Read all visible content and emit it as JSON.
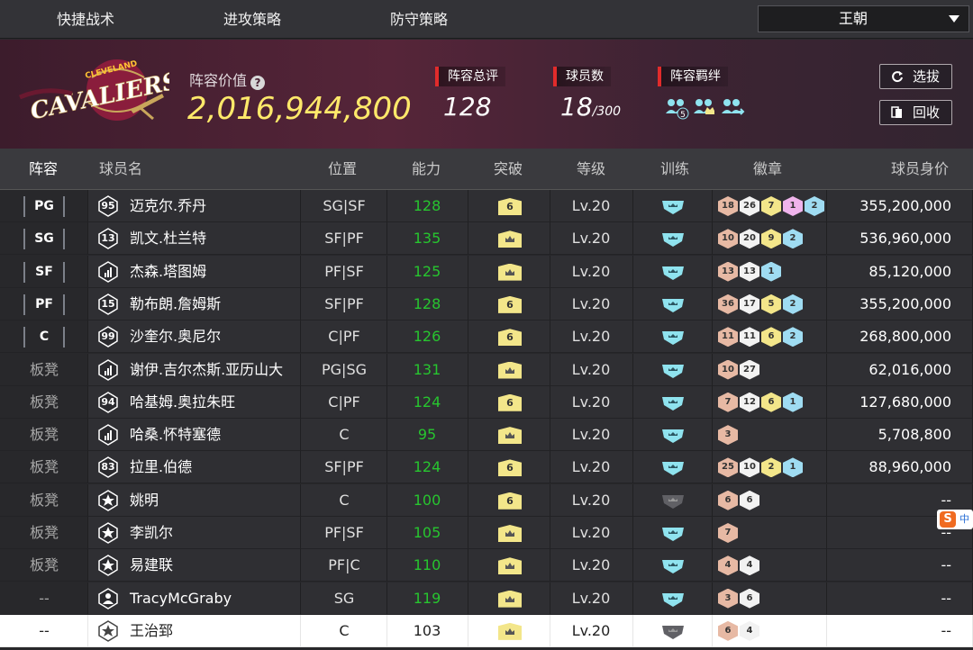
{
  "topnav": {
    "tabs": [
      "快捷战术",
      "进攻策略",
      "防守策略"
    ],
    "dropdown_value": "王朝"
  },
  "team": {
    "logo_text": "CAVALIERS",
    "logo_subtext": "CLEVELAND",
    "value_label": "阵容价值",
    "value": "2,016,944,800",
    "rating_label": "阵容总评",
    "rating": "128",
    "count_label": "球员数",
    "count": "18",
    "count_max": "/300",
    "synergy_label": "阵容羁绊",
    "synergy_icons": [
      "team-synergy-5-icon",
      "team-synergy-crown-icon",
      "team-synergy-arrows-icon"
    ],
    "buttons": {
      "select": "选拔",
      "recycle": "回收"
    }
  },
  "columns": [
    "阵容",
    "球员名",
    "位置",
    "能力",
    "突破",
    "等级",
    "训练",
    "徽章",
    "球员身价"
  ],
  "rows": [
    {
      "slot": "PG",
      "bench": false,
      "emblem": "95",
      "name": "迈克尔.乔丹",
      "pos": "SG|SF",
      "ability": "128",
      "breakthrough": "6",
      "level": "Lv.20",
      "train": "teal",
      "badges": [
        {
          "v": "18",
          "c": "bronze"
        },
        {
          "v": "26",
          "c": "white"
        },
        {
          "v": "7",
          "c": "gold"
        },
        {
          "v": "1",
          "c": "pink"
        },
        {
          "v": "2",
          "c": "blue"
        }
      ],
      "price": "355,200,000"
    },
    {
      "slot": "SG",
      "bench": false,
      "emblem": "13",
      "name": "凯文.杜兰特",
      "pos": "SF|PF",
      "ability": "135",
      "breakthrough": "crown",
      "level": "Lv.20",
      "train": "teal",
      "badges": [
        {
          "v": "10",
          "c": "bronze"
        },
        {
          "v": "20",
          "c": "white"
        },
        {
          "v": "9",
          "c": "gold"
        },
        {
          "v": "2",
          "c": "blue"
        }
      ],
      "price": "536,960,000"
    },
    {
      "slot": "SF",
      "bench": false,
      "emblem": "bars",
      "name": "杰森.塔图姆",
      "pos": "PF|SF",
      "ability": "125",
      "breakthrough": "crown",
      "level": "Lv.20",
      "train": "teal",
      "badges": [
        {
          "v": "13",
          "c": "bronze"
        },
        {
          "v": "13",
          "c": "white"
        },
        {
          "v": "1",
          "c": "blue"
        }
      ],
      "price": "85,120,000"
    },
    {
      "slot": "PF",
      "bench": false,
      "emblem": "15",
      "name": "勒布朗.詹姆斯",
      "pos": "SF|PF",
      "ability": "128",
      "breakthrough": "6",
      "level": "Lv.20",
      "train": "teal",
      "badges": [
        {
          "v": "36",
          "c": "bronze"
        },
        {
          "v": "17",
          "c": "white"
        },
        {
          "v": "5",
          "c": "gold"
        },
        {
          "v": "2",
          "c": "blue"
        }
      ],
      "price": "355,200,000"
    },
    {
      "slot": "C",
      "bench": false,
      "emblem": "99",
      "name": "沙奎尔.奥尼尔",
      "pos": "C|PF",
      "ability": "126",
      "breakthrough": "6",
      "level": "Lv.20",
      "train": "teal",
      "badges": [
        {
          "v": "11",
          "c": "bronze"
        },
        {
          "v": "11",
          "c": "white"
        },
        {
          "v": "6",
          "c": "gold"
        },
        {
          "v": "2",
          "c": "blue"
        }
      ],
      "price": "268,800,000"
    },
    {
      "slot": "板凳",
      "bench": true,
      "emblem": "bars",
      "name": "谢伊.吉尔杰斯.亚历山大",
      "pos": "PG|SG",
      "ability": "131",
      "breakthrough": "crown",
      "level": "Lv.20",
      "train": "teal",
      "badges": [
        {
          "v": "10",
          "c": "bronze"
        },
        {
          "v": "27",
          "c": "white"
        }
      ],
      "price": "62,016,000"
    },
    {
      "slot": "板凳",
      "bench": true,
      "emblem": "94",
      "name": "哈基姆.奥拉朱旺",
      "pos": "C|PF",
      "ability": "124",
      "breakthrough": "6",
      "level": "Lv.20",
      "train": "teal",
      "badges": [
        {
          "v": "7",
          "c": "bronze"
        },
        {
          "v": "12",
          "c": "white"
        },
        {
          "v": "6",
          "c": "gold"
        },
        {
          "v": "1",
          "c": "blue"
        }
      ],
      "price": "127,680,000"
    },
    {
      "slot": "板凳",
      "bench": true,
      "emblem": "bars",
      "name": "哈桑.怀特塞德",
      "pos": "C",
      "ability": "95",
      "breakthrough": "crown",
      "level": "Lv.20",
      "train": "teal",
      "badges": [
        {
          "v": "3",
          "c": "bronze"
        }
      ],
      "price": "5,708,800"
    },
    {
      "slot": "板凳",
      "bench": true,
      "emblem": "83",
      "name": "拉里.伯德",
      "pos": "SF|PF",
      "ability": "124",
      "breakthrough": "6",
      "level": "Lv.20",
      "train": "teal",
      "badges": [
        {
          "v": "25",
          "c": "bronze"
        },
        {
          "v": "10",
          "c": "white"
        },
        {
          "v": "2",
          "c": "gold"
        },
        {
          "v": "1",
          "c": "blue"
        }
      ],
      "price": "88,960,000"
    },
    {
      "slot": "板凳",
      "bench": true,
      "emblem": "star",
      "name": "姚明",
      "pos": "C",
      "ability": "100",
      "breakthrough": "6",
      "level": "Lv.20",
      "train": "gray",
      "badges": [
        {
          "v": "6",
          "c": "bronze"
        },
        {
          "v": "6",
          "c": "white"
        }
      ],
      "price": "--"
    },
    {
      "slot": "板凳",
      "bench": true,
      "emblem": "star",
      "name": "李凯尔",
      "pos": "PF|SF",
      "ability": "105",
      "breakthrough": "crown",
      "level": "Lv.20",
      "train": "teal",
      "badges": [
        {
          "v": "7",
          "c": "bronze"
        }
      ],
      "price": "--"
    },
    {
      "slot": "板凳",
      "bench": true,
      "emblem": "star",
      "name": "易建联",
      "pos": "PF|C",
      "ability": "110",
      "breakthrough": "crown",
      "level": "Lv.20",
      "train": "teal",
      "badges": [
        {
          "v": "4",
          "c": "bronze"
        },
        {
          "v": "4",
          "c": "white"
        }
      ],
      "price": "--"
    },
    {
      "slot": "--",
      "bench": true,
      "emblem": "person",
      "name": "TracyMcGraby",
      "pos": "SG",
      "ability": "119",
      "breakthrough": "crown",
      "level": "Lv.20",
      "train": "teal",
      "badges": [
        {
          "v": "3",
          "c": "bronze"
        },
        {
          "v": "6",
          "c": "white"
        }
      ],
      "price": "--"
    },
    {
      "slot": "--",
      "bench": true,
      "emblem": "star",
      "name": "王治郅",
      "pos": "C",
      "ability": "103",
      "breakthrough": "crown",
      "level": "Lv.20",
      "train": "gray",
      "badges": [
        {
          "v": "6",
          "c": "bronze"
        },
        {
          "v": "4",
          "c": "white"
        }
      ],
      "price": "--",
      "selected": true
    }
  ],
  "ime": {
    "s": "S",
    "label": "中"
  },
  "colors": {
    "ability": "#27c52f",
    "value": "#ffe96a",
    "accent": "#e12b2b",
    "train_teal": "#8fe3ef",
    "train_gray": "#606065",
    "bronze": "#e7b9a4",
    "white": "#f2f2f2",
    "gold": "#f3e68a",
    "pink": "#f0b4ec",
    "blue": "#9fdcf2"
  }
}
